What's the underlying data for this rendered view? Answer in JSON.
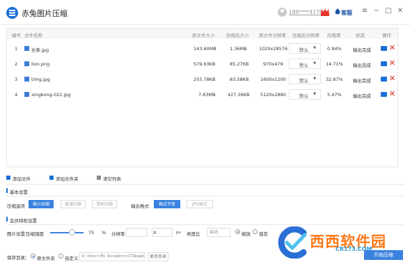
{
  "titlebar": {
    "app_title": "赤兔图片压缩",
    "user_phone": "189****4776",
    "service_label": "客服",
    "window_controls": [
      "≡",
      "−",
      "□",
      "✕"
    ]
  },
  "table": {
    "headers": {
      "index": "编号",
      "name": "文件名称",
      "orig_size": "原文件大小",
      "comp_size": "压缩后大小",
      "orig_res": "原文件分辨率",
      "comp_res": "压缩后分辨率",
      "ratio": "压缩率",
      "status": "状态",
      "ops": "操作"
    },
    "rows": [
      {
        "index": "1",
        "name": "长条.jpg",
        "orig_size": "143.60MB",
        "comp_size": "1.36MB",
        "orig_res": "1020x28576",
        "comp_res": "默认",
        "ratio": "0.94%",
        "status": "输出完成"
      },
      {
        "index": "2",
        "name": "lion.png",
        "orig_size": "579.63KB",
        "comp_size": "85.27KB",
        "orig_res": "970x479",
        "comp_res": "默认",
        "ratio": "14.71%",
        "status": "输出完成"
      },
      {
        "index": "3",
        "name": "timg.jpg",
        "orig_size": "255.78KB",
        "comp_size": "83.58KB",
        "orig_res": "1600x1200",
        "comp_res": "默认",
        "ratio": "32.67%",
        "status": "输出完成"
      },
      {
        "index": "4",
        "name": "xingkong-022.jpg",
        "orig_size": "7.63MB",
        "comp_size": "427.36KB",
        "orig_res": "5120x2880",
        "comp_res": "默认",
        "ratio": "5.47%",
        "status": "输出完成"
      }
    ]
  },
  "actions": {
    "add_file": "添加文件",
    "add_folder": "添加文件夹",
    "clear_list": "清空列表"
  },
  "basic": {
    "title": "基本设置",
    "compress_label": "压缩选项",
    "compress_options": [
      "缩小压缩",
      "普通压缩",
      "清晰压缩"
    ],
    "format_label": "输出格式",
    "format_options": [
      "格式不变",
      "JPG格式"
    ]
  },
  "member": {
    "title": "会员特权设置",
    "image_label": "图片设置：",
    "strength_label": "压缩强度",
    "strength_value": "75",
    "percent": "%",
    "resolution_label": "分辨率",
    "x_sep": "X",
    "px": "px",
    "brightness_label": "亮度比",
    "brightness_value": "自动",
    "scale_label": "缩放",
    "crop_label": "裁剪"
  },
  "save": {
    "label": "保存目录：",
    "orig_folder": "原文件夹",
    "custom": "自定义",
    "path": "D:\\Users\\My Documents\\CTImageC",
    "change_dir": "更改目录",
    "start": "开始压缩"
  },
  "watermark": {
    "text": "西西软件园",
    "url": "CR173.COM"
  },
  "colors": {
    "accent": "#3a82e0",
    "delete": "#e0271b",
    "watermark_orange": "#ff7a1a"
  }
}
